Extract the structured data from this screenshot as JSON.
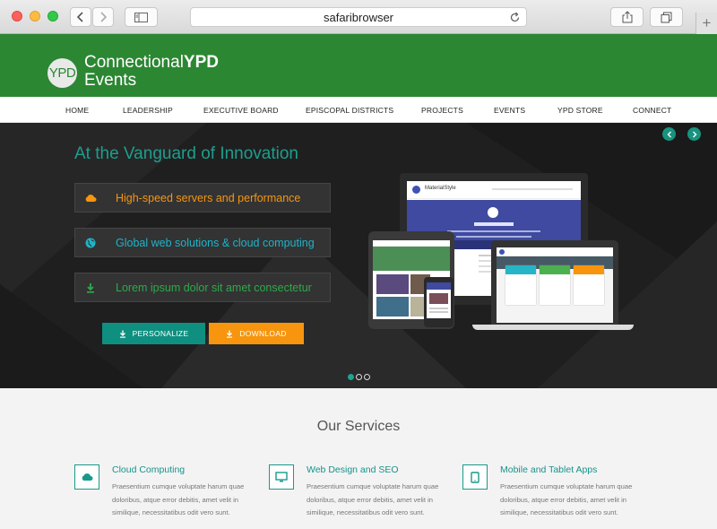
{
  "browser": {
    "url": "safaribrowser"
  },
  "brand": {
    "logo": "YPD",
    "name_part1": "Connectional",
    "name_part2": "YPD",
    "subtitle": "Events",
    "color": "#2c8733"
  },
  "nav": {
    "items": [
      "HOME",
      "LEADERSHIP",
      "EXECUTIVE BOARD",
      "EPISCOPAL DISTRICTS",
      "PROJECTS",
      "EVENTS",
      "YPD STORE",
      "CONNECT"
    ]
  },
  "hero": {
    "title": "At the Vanguard of Innovation",
    "features": [
      {
        "icon": "cloud-icon",
        "text": "High-speed servers and performance",
        "color": "#f7950e"
      },
      {
        "icon": "globe-icon",
        "text": "Global web solutions & cloud computing",
        "color": "#1fb3c9"
      },
      {
        "icon": "download-icon",
        "text": "Lorem ipsum dolor sit amet consectetur",
        "color": "#2eaa4a"
      }
    ],
    "buttons": {
      "personalize": "PERSONALIZE",
      "download": "DOWNLOAD"
    },
    "mockup_brand": "MaterialStyle",
    "slide_count": 3,
    "active_slide": 1
  },
  "services": {
    "title": "Our Services",
    "items": [
      {
        "icon": "cloud-icon",
        "title": "Cloud Computing",
        "text": "Praesentium cumque voluptate harum quae doloribus, atque error debitis, amet velit in similique, necessitatibus odit vero sunt."
      },
      {
        "icon": "monitor-icon",
        "title": "Web Design and SEO",
        "text": "Praesentium cumque voluptate harum quae doloribus, atque error debitis, amet velit in similique, necessitatibus odit vero sunt."
      },
      {
        "icon": "tablet-icon",
        "title": "Mobile and Tablet Apps",
        "text": "Praesentium cumque voluptate harum quae doloribus, atque error debitis, amet velit in similique, necessitatibus odit vero sunt."
      }
    ]
  }
}
